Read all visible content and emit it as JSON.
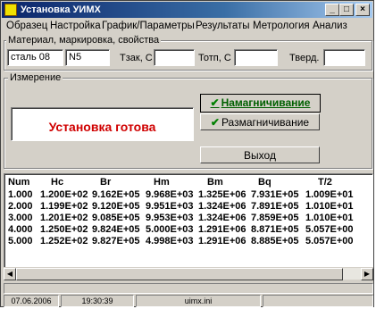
{
  "window": {
    "title": "Установка УИМХ"
  },
  "titlebar_buttons": [
    "_",
    "□",
    "×"
  ],
  "menu": [
    "Образец",
    "Настройка",
    "График/Параметры",
    "Результаты",
    "Метрология",
    "Анализ"
  ],
  "material": {
    "group_label": "Материал, маркировка, свойства",
    "material_value": "сталь 08",
    "marking_value": "N5",
    "tzak_label": "Тзак, С",
    "tzak_value": "",
    "totp_label": "Тотп, С",
    "totp_value": "",
    "hardness_label": "Тверд.",
    "hardness_value": ""
  },
  "measurement": {
    "group_label": "Измерение",
    "status": "Установка готова",
    "magnetize_label": "Намагничивание",
    "demagnetize_label": "Размагничивание",
    "exit_label": "Выход"
  },
  "table": {
    "columns": [
      "Num",
      "Hc",
      "Br",
      "Hm",
      "Bm",
      "Bq",
      "T/2"
    ],
    "rows": [
      [
        "1.000",
        "1.200E+02",
        "9.162E+05",
        "9.968E+03",
        "1.325E+06",
        "7.931E+05",
        "1.009E+01"
      ],
      [
        "2.000",
        "1.199E+02",
        "9.120E+05",
        "9.951E+03",
        "1.324E+06",
        "7.891E+05",
        "1.010E+01"
      ],
      [
        "3.000",
        "1.201E+02",
        "9.085E+05",
        "9.953E+03",
        "1.324E+06",
        "7.859E+05",
        "1.010E+01"
      ],
      [
        "4.000",
        "1.250E+02",
        "9.824E+05",
        "5.000E+03",
        "1.291E+06",
        "8.871E+05",
        "5.057E+00"
      ],
      [
        "5.000",
        "1.252E+02",
        "9.827E+05",
        "4.998E+03",
        "1.291E+06",
        "8.885E+05",
        "5.057E+00"
      ]
    ]
  },
  "statusbar": {
    "date": "07.06.2006",
    "time": "19:30:39",
    "ini": "uimx.ini"
  },
  "colors": {
    "status_text": "#d00000",
    "check": "#008000",
    "title_bg": "#0a246a"
  },
  "icons": {
    "app": "app-icon",
    "check": "checkmark-icon"
  }
}
